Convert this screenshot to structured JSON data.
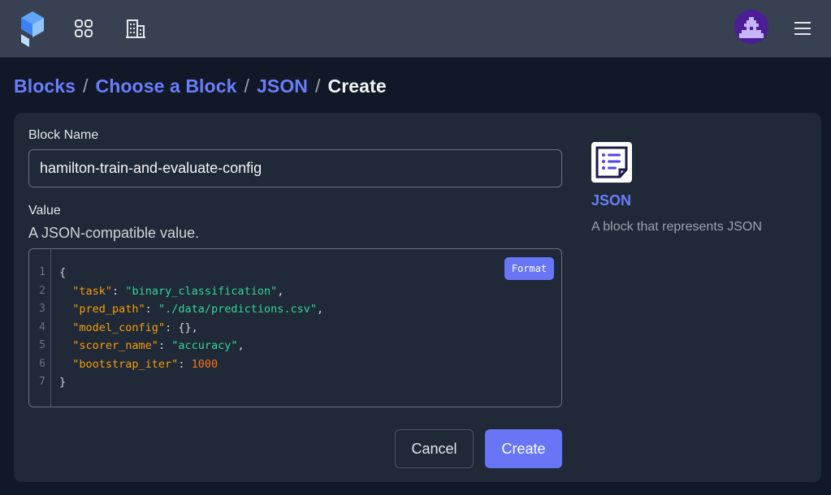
{
  "topbar": {
    "logo_icon": "prefect-logo-icon",
    "nav_icons": [
      "grid-icon",
      "building-icon"
    ],
    "avatar_icon": "pixel-avatar-icon",
    "menu_icon": "hamburger-menu-icon"
  },
  "breadcrumb": {
    "items": [
      "Blocks",
      "Choose a Block",
      "JSON"
    ],
    "current": "Create",
    "separator": "/"
  },
  "form": {
    "name_label": "Block Name",
    "name_value": "hamilton-train-and-evaluate-config",
    "value_label": "Value",
    "value_description": "A JSON-compatible value.",
    "format_label": "Format",
    "line_numbers": [
      "1",
      "2",
      "3",
      "4",
      "5",
      "6",
      "7"
    ],
    "code": {
      "open": "{",
      "entries": [
        {
          "key": "\"task\"",
          "value": "\"binary_classification\"",
          "sep": ",",
          "type": "string"
        },
        {
          "key": "\"pred_path\"",
          "value": "\"./data/predictions.csv\"",
          "sep": ",",
          "type": "string"
        },
        {
          "key": "\"model_config\"",
          "value": "{}",
          "sep": ",",
          "type": "plain"
        },
        {
          "key": "\"scorer_name\"",
          "value": "\"accuracy\"",
          "sep": ",",
          "type": "string"
        },
        {
          "key": "\"bootstrap_iter\"",
          "value": "1000",
          "sep": "",
          "type": "number"
        }
      ],
      "close": "}"
    },
    "cancel_label": "Cancel",
    "create_label": "Create"
  },
  "block_info": {
    "icon": "json-document-icon",
    "title": "JSON",
    "description": "A block that represents JSON"
  },
  "colors": {
    "accent": "#6875f5",
    "link": "#6b7dfb",
    "key": "#f59e0b",
    "string": "#34d399",
    "number": "#f97316"
  }
}
